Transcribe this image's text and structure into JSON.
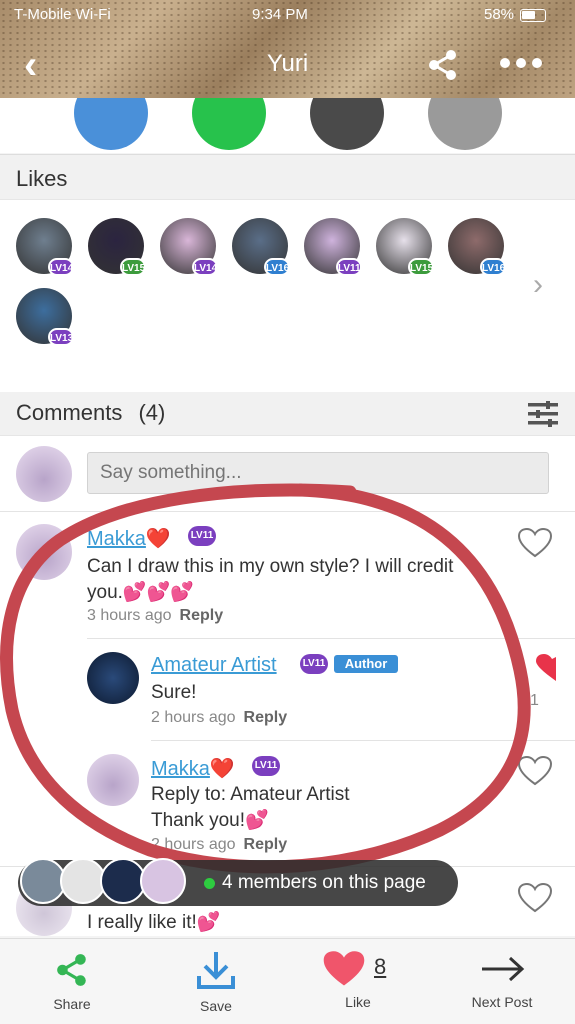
{
  "status_bar": {
    "carrier": "T-Mobile Wi-Fi",
    "time": "9:34 PM",
    "battery": "58%"
  },
  "header": {
    "title": "Yuri"
  },
  "likes": {
    "label": "Likes",
    "users": [
      {
        "level": "LV14",
        "badge_color": "#7b3fbf",
        "avatar_color": "#6f7f8f"
      },
      {
        "level": "LV15",
        "badge_color": "#3c9b3c",
        "avatar_color": "#2b2440"
      },
      {
        "level": "LV14",
        "badge_color": "#7b3fbf",
        "avatar_color": "#d9b6d8"
      },
      {
        "level": "LV16",
        "badge_color": "#2f7fd0",
        "avatar_color": "#5a6e88"
      },
      {
        "level": "LV11",
        "badge_color": "#7b3fbf",
        "avatar_color": "#cfb3dd"
      },
      {
        "level": "LV15",
        "badge_color": "#3c9b3c",
        "avatar_color": "#e6e0ea"
      },
      {
        "level": "LV16",
        "badge_color": "#2f7fd0",
        "avatar_color": "#8e6b6b"
      },
      {
        "level": "LV13",
        "badge_color": "#7b3fbf",
        "avatar_color": "#3d6e9e"
      }
    ]
  },
  "comments": {
    "label": "Comments",
    "count": "(4)",
    "input_placeholder": "Say something...",
    "items": [
      {
        "user": "Makka",
        "emoji": "❤️",
        "level": "LV11",
        "text_line1": "Can I draw this in my own style? I will credit",
        "text_line2": "you.💕💕💕",
        "time": "3 hours ago",
        "reply": "Reply"
      },
      {
        "user": "Amateur Artist",
        "level": "LV11",
        "badge": "Author",
        "text_line1": "Sure!",
        "time": "2 hours ago",
        "reply": "Reply",
        "likes": "1"
      },
      {
        "user": "Makka",
        "emoji": "❤️",
        "level": "LV11",
        "text_line1": "Reply to: Amateur Artist",
        "text_line2": "Thank you!💕",
        "time": "2 hours ago",
        "reply": "Reply"
      },
      {
        "text_line1": "I really like it!💕"
      }
    ]
  },
  "toast": {
    "text": "4 members on this page"
  },
  "bottom_bar": {
    "share": "Share",
    "save": "Save",
    "like": "Like",
    "like_count": "8",
    "next": "Next Post"
  }
}
